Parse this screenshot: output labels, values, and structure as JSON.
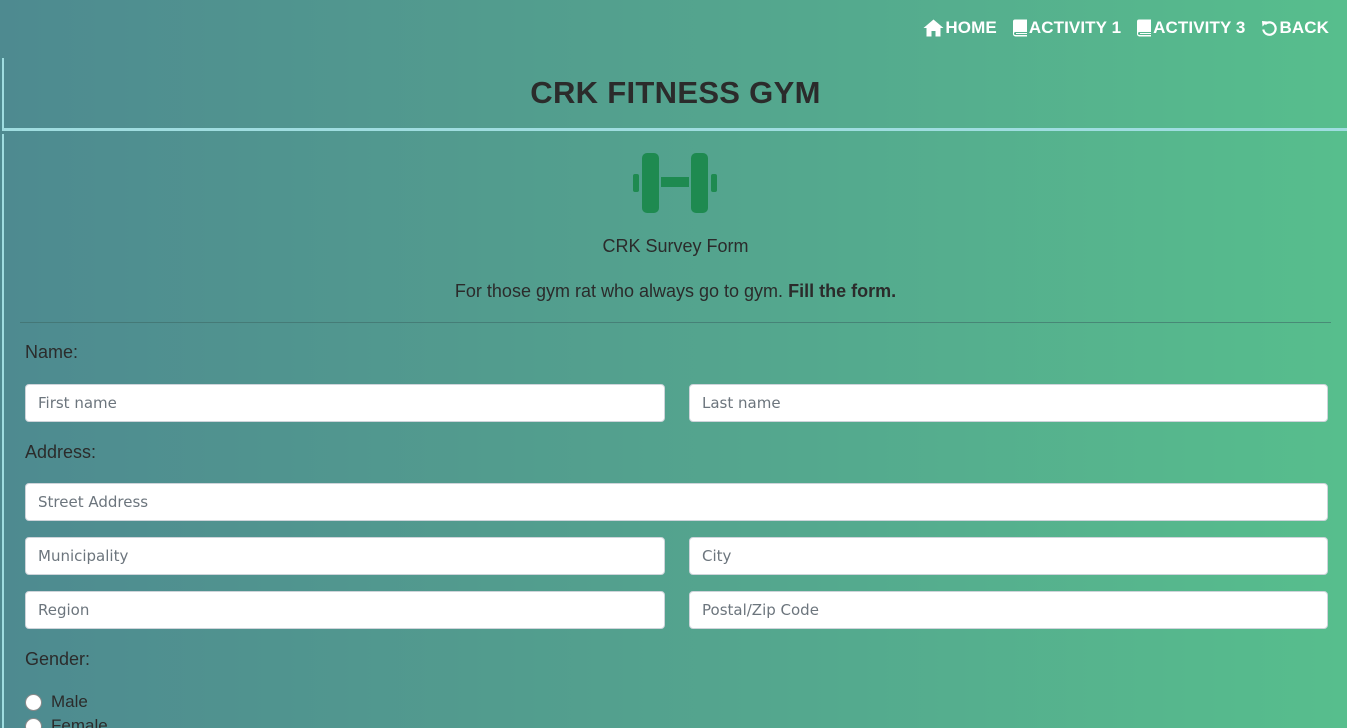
{
  "nav": {
    "items": [
      {
        "label": "HOME",
        "icon": "home-icon"
      },
      {
        "label": "ACTIVITY 1",
        "icon": "book-icon"
      },
      {
        "label": "ACTIVITY 3",
        "icon": "book-icon"
      },
      {
        "label": "BACK",
        "icon": "undo-icon"
      }
    ]
  },
  "header": {
    "title": "CRK FITNESS GYM"
  },
  "form": {
    "logo_icon": "dumbbell-icon",
    "logo_color": "#1e8a50",
    "title": "CRK Survey Form",
    "subtitle": "For those gym rat who always go to gym.",
    "subtitle_bold": "Fill the form.",
    "name_label": "Name:",
    "first_name_placeholder": "First name",
    "last_name_placeholder": "Last name",
    "address_label": "Address:",
    "street_placeholder": "Street Address",
    "municipality_placeholder": "Municipality",
    "city_placeholder": "City",
    "region_placeholder": "Region",
    "postal_placeholder": "Postal/Zip Code",
    "gender_label": "Gender:",
    "gender_options": [
      "Male",
      "Female"
    ]
  }
}
